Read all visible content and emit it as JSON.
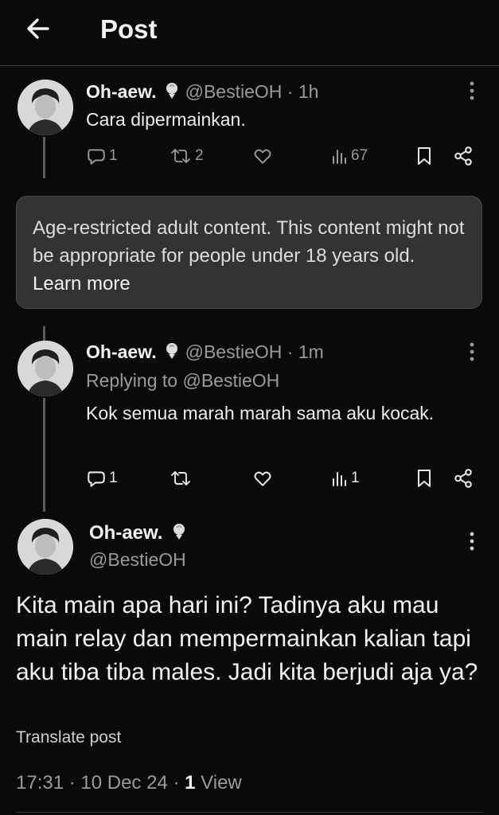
{
  "header": {
    "title": "Post"
  },
  "tweet1": {
    "name": "Oh-aew.",
    "handle": "@BestieOH",
    "sep": "·",
    "time": "1h",
    "text": "Cara dipermainkan.",
    "replies": "1",
    "reposts": "2",
    "likes": "",
    "views": "67"
  },
  "warning": {
    "text": "Age-restricted adult content. This content might not be appropriate for people under 18 years old.",
    "link": "Learn more"
  },
  "tweet2": {
    "name": "Oh-aew.",
    "handle": "@BestieOH",
    "sep": "·",
    "time": "1m",
    "replying_prefix": "Replying to",
    "replying_to": "@BestieOH",
    "text": "Kok semua marah marah sama aku kocak.",
    "replies": "1",
    "reposts": "",
    "likes": "",
    "views": "1"
  },
  "main": {
    "name": "Oh-aew.",
    "handle": "@BestieOH",
    "text": "Kita main apa hari ini? Tadinya aku mau main relay dan mempermainkan kalian tapi aku tiba tiba males. Jadi kita berjudi aja ya?",
    "translate": "Translate post",
    "time": "17:31",
    "date": "10 Dec 24",
    "views_count": "1",
    "views_label": "View"
  },
  "icons": {
    "back": "arrow-left-icon",
    "more": "more-vertical-icon",
    "reply": "reply-icon",
    "repost": "repost-icon",
    "like": "heart-icon",
    "views": "views-icon",
    "bookmark": "bookmark-icon",
    "share": "share-icon",
    "badge": "microphone-badge-icon"
  }
}
